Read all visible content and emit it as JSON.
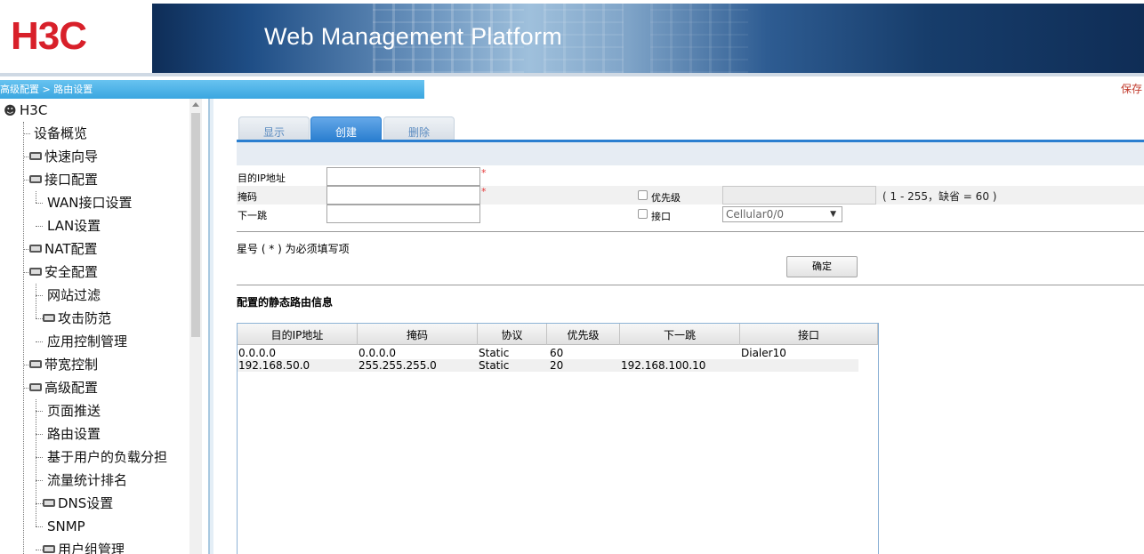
{
  "header": {
    "logo_text": "H3C",
    "platform_title": "Web Management Platform",
    "brand_color": "#d8202a"
  },
  "breadcrumb": {
    "text": "高级配置 > 路由设置",
    "save_label": "保存"
  },
  "sidebar": {
    "root_label": "H3C",
    "items": [
      {
        "label": "设备概览",
        "level": 1,
        "folder": false
      },
      {
        "label": "快速向导",
        "level": 1,
        "folder": true
      },
      {
        "label": "接口配置",
        "level": 1,
        "folder": true
      },
      {
        "label": "WAN接口设置",
        "level": 2,
        "folder": false
      },
      {
        "label": "LAN设置",
        "level": 2,
        "folder": false
      },
      {
        "label": "NAT配置",
        "level": 1,
        "folder": true
      },
      {
        "label": "安全配置",
        "level": 1,
        "folder": true
      },
      {
        "label": "网站过滤",
        "level": 2,
        "folder": false
      },
      {
        "label": "攻击防范",
        "level": 2,
        "folder": true
      },
      {
        "label": "应用控制管理",
        "level": 2,
        "folder": false
      },
      {
        "label": "带宽控制",
        "level": 1,
        "folder": true
      },
      {
        "label": "高级配置",
        "level": 1,
        "folder": true
      },
      {
        "label": "页面推送",
        "level": 2,
        "folder": false
      },
      {
        "label": "路由设置",
        "level": 2,
        "folder": false
      },
      {
        "label": "基于用户的负载分担",
        "level": 2,
        "folder": false
      },
      {
        "label": "流量统计排名",
        "level": 2,
        "folder": false
      },
      {
        "label": "DNS设置",
        "level": 2,
        "folder": true
      },
      {
        "label": "SNMP",
        "level": 2,
        "folder": false
      },
      {
        "label": "用户组管理",
        "level": 2,
        "folder": true
      }
    ]
  },
  "tabs": [
    {
      "label": "显示",
      "active": false
    },
    {
      "label": "创建",
      "active": true
    },
    {
      "label": "删除",
      "active": false
    }
  ],
  "form": {
    "dest_ip_label": "目的IP地址",
    "dest_ip_value": "",
    "mask_label": "掩码",
    "mask_value": "",
    "next_hop_label": "下一跳",
    "next_hop_value": "",
    "required_mark": "*",
    "priority_label": "优先级",
    "priority_value": "",
    "priority_hint": "( 1 - 255，缺省 = 60 )",
    "interface_label": "接口",
    "interface_value": "Cellular0/0",
    "required_note": "星号 ( * ) 为必须填写项",
    "confirm_label": "确定"
  },
  "routes": {
    "section_title": "配置的静态路由信息",
    "columns": [
      "目的IP地址",
      "掩码",
      "协议",
      "优先级",
      "下一跳",
      "接口"
    ],
    "rows": [
      [
        "0.0.0.0",
        "0.0.0.0",
        "Static",
        "60",
        "",
        "Dialer10"
      ],
      [
        "192.168.50.0",
        "255.255.255.0",
        "Static",
        "20",
        "192.168.100.10",
        ""
      ]
    ]
  }
}
